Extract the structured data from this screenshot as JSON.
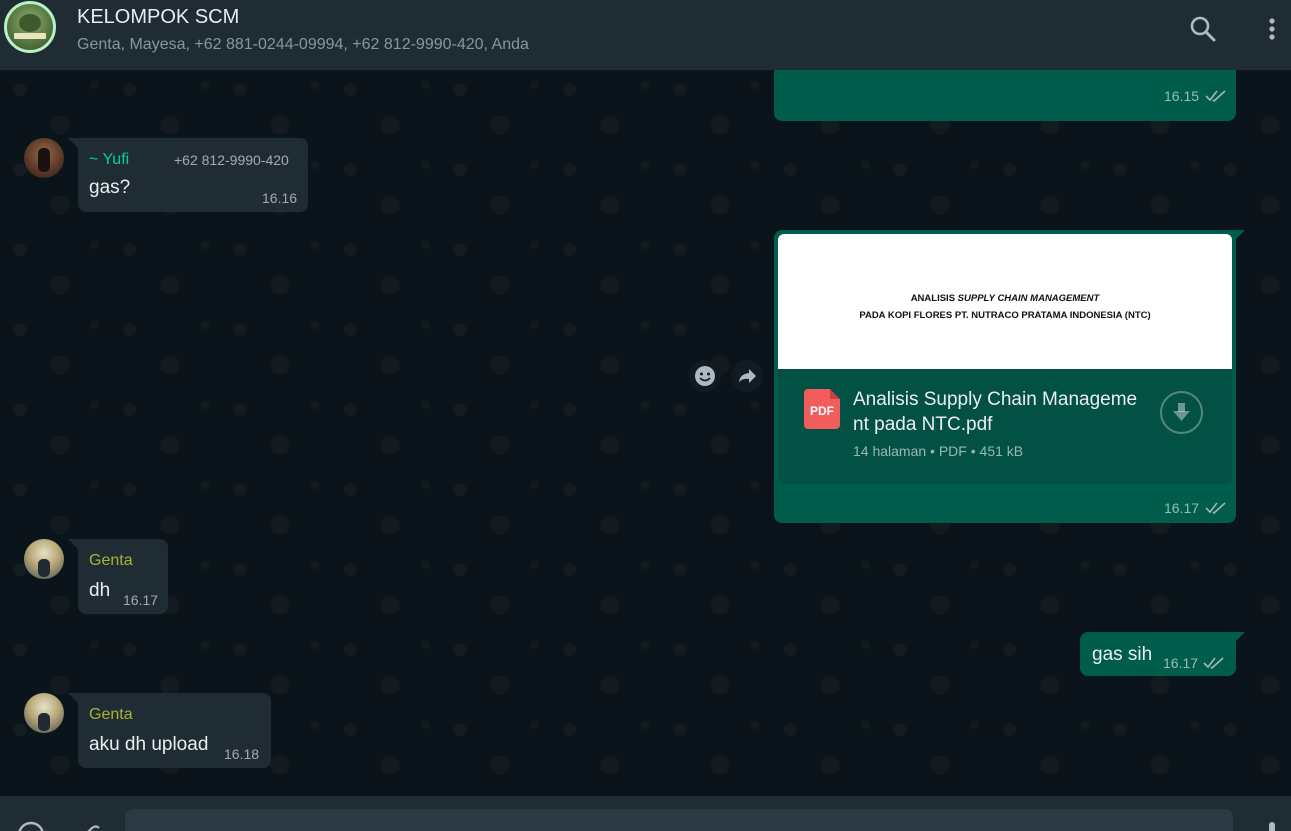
{
  "header": {
    "title": "KELOMPOK SCM",
    "members": "Genta, Mayesa, +62 881-0244-09994, +62 812-9990-420, Anda",
    "icons": [
      "search-icon",
      "menu-icon"
    ]
  },
  "messages": {
    "m0": {
      "time": "16.15"
    },
    "m1": {
      "sender": "~ Yufi",
      "phone": "+62 812-9990-420",
      "text": "gas?",
      "time": "16.16"
    },
    "m2": {
      "doc_title_line1_a": "ANALISIS ",
      "doc_title_line1_b": "SUPPLY CHAIN MANAGEMENT",
      "doc_title_line2": "PADA KOPI FLORES PT. NUTRACO PRATAMA INDONESIA (NTC)",
      "pdf_label": "PDF",
      "file_name": "Analisis Supply Chain Manageme nt pada NTC.pdf",
      "file_meta": "14 halaman • PDF • 451 kB",
      "time": "16.17"
    },
    "m3": {
      "sender": "Genta",
      "text": "dh",
      "time": "16.17"
    },
    "m4": {
      "text": "gas sih",
      "time": "16.17"
    },
    "m5": {
      "sender": "Genta",
      "text": "aku dh upload",
      "time": "16.18"
    }
  },
  "colors": {
    "incoming": "#202c33",
    "outgoing": "#005c4b",
    "sender_yufi": "#06cf9c",
    "sender_genta": "#a5b337",
    "background": "#0b141a"
  }
}
